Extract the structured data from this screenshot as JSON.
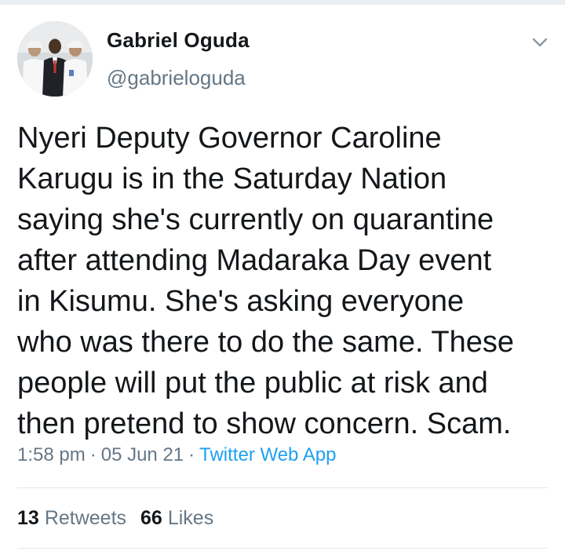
{
  "user": {
    "name": "Gabriel Oguda",
    "handle": "@gabrieloguda",
    "avatar_icon": "profile-photo"
  },
  "menu_icon": "chevron-down-icon",
  "tweet": {
    "text": "Nyeri Deputy Governor Caroline\nKarugu is in the Saturday Nation\nsaying she's currently on quarantine\nafter attending Madaraka Day event\nin Kisumu. She's asking everyone\nwho was there to do the same. These\npeople will put the public at risk and\nthen pretend to show concern. Scam.",
    "time": "1:58 pm",
    "date": "05 Jun 21",
    "separator": "·",
    "source": "Twitter Web App"
  },
  "stats": {
    "retweets_count": "13",
    "retweets_label": "Retweets",
    "likes_count": "66",
    "likes_label": "Likes"
  },
  "colors": {
    "text": "#14171a",
    "secondary": "#657786",
    "link": "#1da1f2",
    "divider": "#e1e8ed"
  }
}
